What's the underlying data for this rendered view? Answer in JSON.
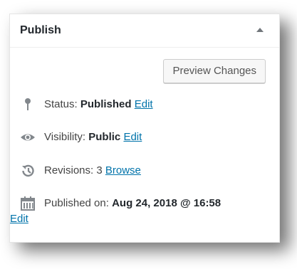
{
  "panel": {
    "title": "Publish",
    "preview_button": "Preview Changes"
  },
  "status": {
    "label": "Status:",
    "value": "Published",
    "edit": "Edit",
    "icon": "pin-icon"
  },
  "visibility": {
    "label": "Visibility:",
    "value": "Public",
    "edit": "Edit",
    "icon": "eye-icon"
  },
  "revisions": {
    "label": "Revisions: 3",
    "browse": "Browse",
    "icon": "history-icon"
  },
  "published": {
    "label": "Published on:",
    "value": "Aug 24, 2018 @ 16:58",
    "edit": "Edit",
    "icon": "calendar-icon"
  },
  "colors": {
    "link": "#0073aa",
    "icon": "#82878c",
    "title": "#23282d"
  }
}
